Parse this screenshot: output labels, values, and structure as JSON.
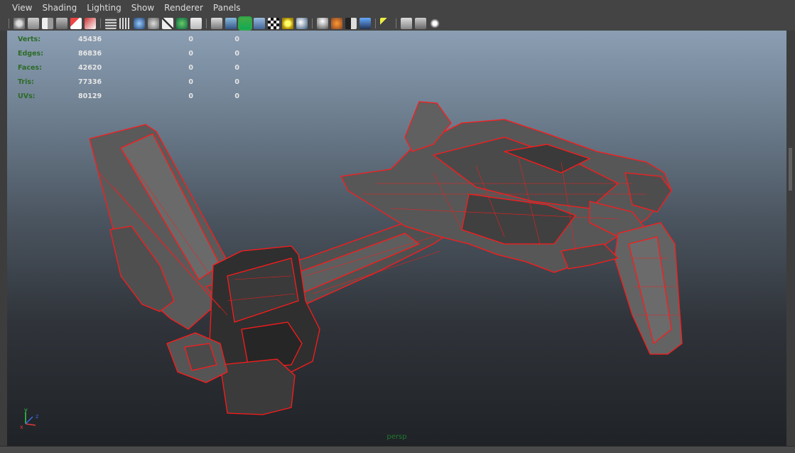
{
  "menu": [
    "View",
    "Shading",
    "Lighting",
    "Show",
    "Renderer",
    "Panels"
  ],
  "toolbar": {
    "groups": [
      [
        "camera-attributes-icon",
        "bookmark-icon",
        "image-plane-icon",
        "2d-pan-zoom-icon",
        "grease-pencil-icon",
        "render-icon"
      ],
      [
        "wireframe-icon",
        "grid-icon",
        "smooth-shade-icon",
        "flat-shade-icon",
        "bounding-box-icon",
        "texture-icon",
        "text-icon"
      ],
      [
        "wireframe-on-shaded-icon",
        "default-material-icon",
        "xray-active-icon",
        "xray-joints-icon",
        "checker-icon",
        "lights-icon",
        "ambient-occlusion-icon"
      ],
      [
        "shadows-icon",
        "motion-blur-icon",
        "anti-alias-icon",
        "depth-of-field-icon"
      ],
      [
        "select-camera-icon"
      ],
      [
        "isolate-select-icon",
        "frame-all-icon",
        "node-editor-icon"
      ]
    ],
    "active": "xray-active-icon"
  },
  "hud": {
    "rows": [
      {
        "label": "Verts:",
        "v1": "45436",
        "v2": "0",
        "v3": "0"
      },
      {
        "label": "Edges:",
        "v1": "86836",
        "v2": "0",
        "v3": "0"
      },
      {
        "label": "Faces:",
        "v1": "42620",
        "v2": "0",
        "v3": "0"
      },
      {
        "label": "Tris:",
        "v1": "77336",
        "v2": "0",
        "v3": "0"
      },
      {
        "label": "UVs:",
        "v1": "80129",
        "v2": "0",
        "v3": "0"
      }
    ]
  },
  "camera_label": "persp",
  "axis": {
    "x": "x",
    "y": "y",
    "z": "z"
  },
  "colors": {
    "wireframe": "#ff1a1a",
    "mesh_fill": "#5c5c5c",
    "hud_label": "#2b6b25",
    "camera_label": "#1f7a2e"
  }
}
